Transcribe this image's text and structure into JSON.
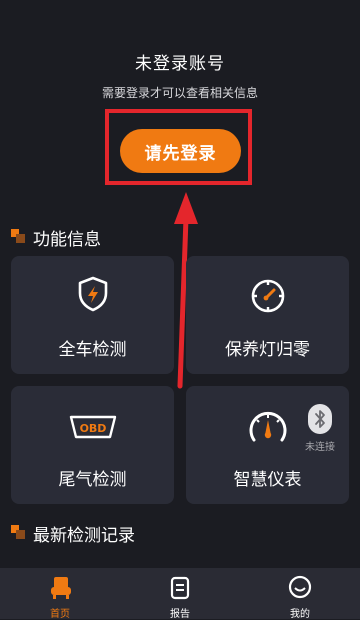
{
  "login": {
    "title": "未登录账号",
    "subtitle": "需要登录才可以查看相关信息",
    "button": "请先登录"
  },
  "sections": {
    "features_title": "功能信息",
    "records_title": "最新检测记录"
  },
  "cards": [
    {
      "label": "全车检测",
      "icon": "shield-bolt-icon"
    },
    {
      "label": "保养灯归零",
      "icon": "gauge-reset-icon"
    },
    {
      "label": "尾气检测",
      "icon": "obd-icon",
      "icon_text": "OBD"
    },
    {
      "label": "智慧仪表",
      "icon": "speedometer-icon"
    }
  ],
  "bluetooth": {
    "status": "未连接",
    "icon": "bluetooth-icon"
  },
  "nav": [
    {
      "label": "首页",
      "icon": "car-seat-icon",
      "active": true
    },
    {
      "label": "报告",
      "icon": "report-icon",
      "active": false
    },
    {
      "label": "我的",
      "icon": "smile-icon",
      "active": false
    }
  ],
  "colors": {
    "accent": "#f07a12",
    "annotation_red": "#e4262c",
    "background": "#1b1c22",
    "card": "#2a2c37"
  }
}
